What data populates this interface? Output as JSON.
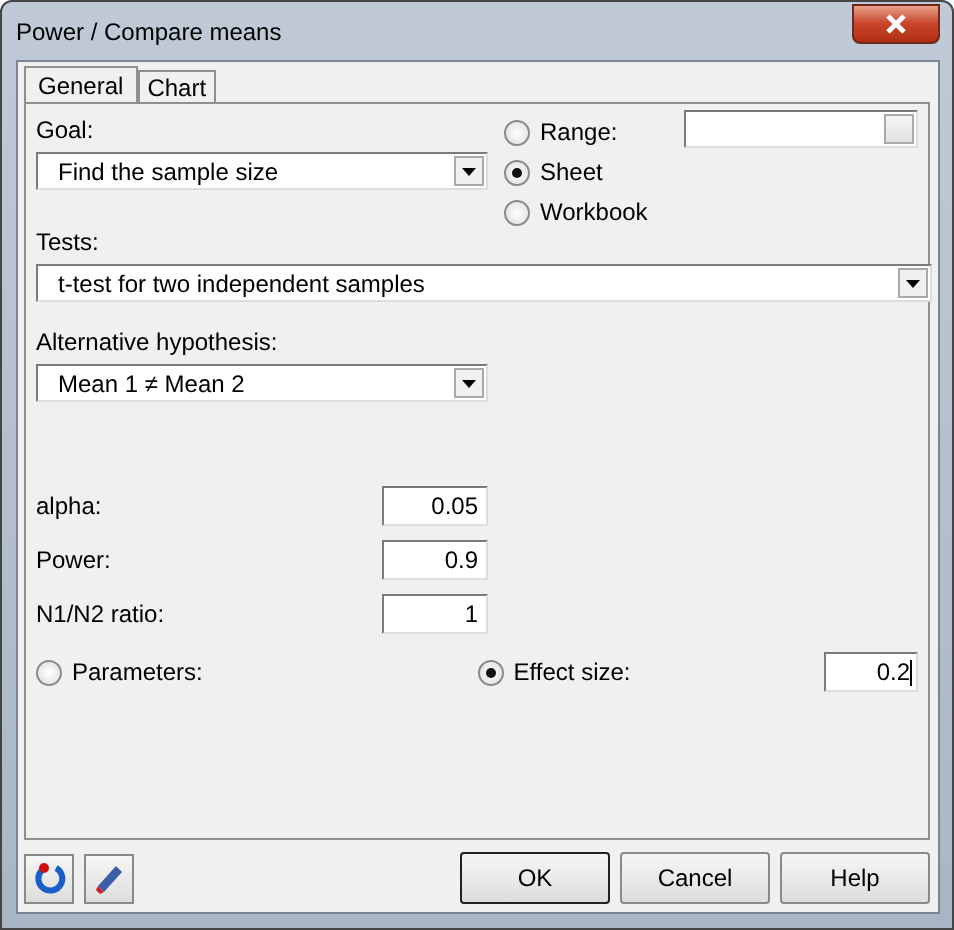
{
  "window": {
    "title": "Power / Compare means"
  },
  "tabs": [
    {
      "label": "General",
      "selected": true
    },
    {
      "label": "Chart",
      "selected": false
    }
  ],
  "goal": {
    "label": "Goal:",
    "value": "Find the sample size"
  },
  "destination": [
    {
      "label": "Range:",
      "selected": false
    },
    {
      "label": "Sheet",
      "selected": true
    },
    {
      "label": "Workbook",
      "selected": false
    }
  ],
  "tests": {
    "label": "Tests:",
    "value": "t-test for two independent samples"
  },
  "alternative": {
    "label": "Alternative hypothesis:",
    "value": "Mean 1 ≠ Mean 2"
  },
  "parameters": [
    {
      "label": "alpha:",
      "value": "0.05"
    },
    {
      "label": "Power:",
      "value": "0.9"
    },
    {
      "label": "N1/N2 ratio:",
      "value": "1"
    }
  ],
  "mode": [
    {
      "label": "Parameters:",
      "selected": false
    },
    {
      "label": "Effect size:",
      "selected": true
    }
  ],
  "effect_size": {
    "value": "0.2"
  },
  "buttons": [
    {
      "label": "OK",
      "default": true
    },
    {
      "label": "Cancel",
      "default": false
    },
    {
      "label": "Help",
      "default": false
    }
  ]
}
